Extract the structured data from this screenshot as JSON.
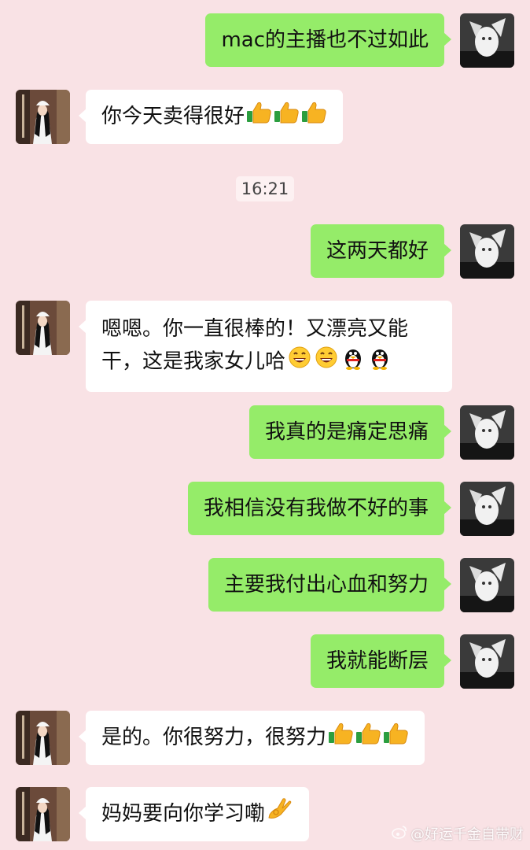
{
  "timestamp": "16:21",
  "messages": [
    {
      "text": "mac的主播也不过如此"
    },
    {
      "text": "你今天卖得很好"
    },
    {
      "text": "这两天都好"
    },
    {
      "text": "嗯嗯。你一直很棒的！又漂亮又能干，这是我家女儿哈"
    },
    {
      "text": "我真的是痛定思痛"
    },
    {
      "text": "我相信没有我做不好的事"
    },
    {
      "text": "主要我付出心血和努力"
    },
    {
      "text": "我就能断层"
    },
    {
      "text": "是的。你很努力，很努力"
    },
    {
      "text": "妈妈要向你学习嘞"
    }
  ],
  "emojis": {
    "thumbs": "thumbs-up-icon",
    "grin": "grin-emoji-icon",
    "penguin": "qq-penguin-icon",
    "ok": "ok-hand-icon"
  },
  "watermark": "@好运千金自带财",
  "colors": {
    "background": "#f9e2e5",
    "outgoing_bubble": "#95ec69",
    "incoming_bubble": "#ffffff"
  }
}
